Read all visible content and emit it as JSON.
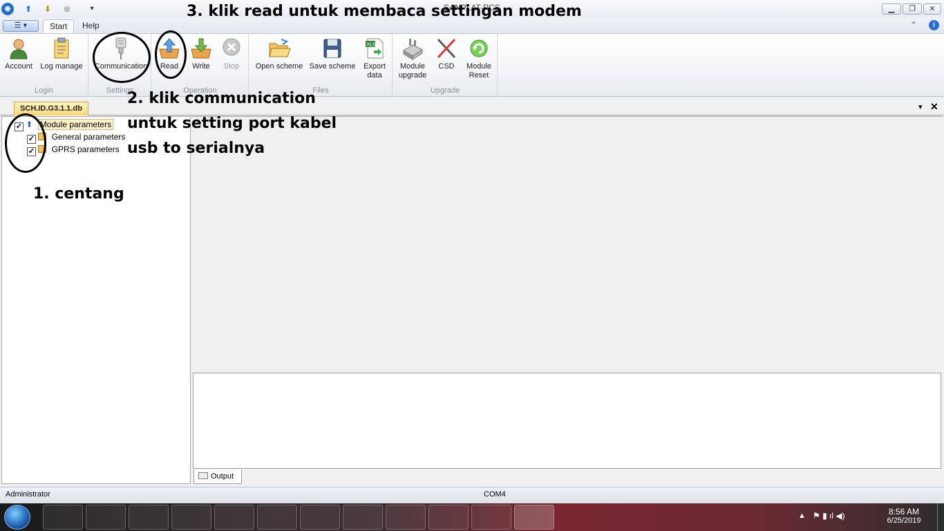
{
  "app": {
    "title": "SANPLAT-PCS",
    "menu_tab": "Start",
    "help_tab": "Help"
  },
  "ribbon": {
    "groups": [
      {
        "label": "Login",
        "buttons": [
          {
            "label": "Account"
          },
          {
            "label": "Log manage"
          }
        ]
      },
      {
        "label": "Settings",
        "buttons": [
          {
            "label": "Communication"
          }
        ]
      },
      {
        "label": "Operation",
        "buttons": [
          {
            "label": "Read"
          },
          {
            "label": "Write"
          },
          {
            "label": "Stop"
          }
        ]
      },
      {
        "label": "Files",
        "buttons": [
          {
            "label": "Open scheme"
          },
          {
            "label": "Save scheme"
          },
          {
            "label": "Export",
            "label2": "data"
          }
        ]
      },
      {
        "label": "Upgrade",
        "buttons": [
          {
            "label": "Module",
            "label2": "upgrade"
          },
          {
            "label": "CSD"
          },
          {
            "label": "Module",
            "label2": "Reset"
          }
        ]
      }
    ]
  },
  "document": {
    "tab_label": "SCH.ID.G3.1.1.db"
  },
  "tree": {
    "root": "Module parameters",
    "children": [
      "General parameters",
      "GPRS parameters"
    ]
  },
  "output": {
    "tab_label": "Output"
  },
  "status": {
    "user": "Administrator",
    "port": "COM4"
  },
  "tray": {
    "time": "8:56 AM",
    "date": "6/25/2019"
  },
  "annotations": {
    "step3": "3. klik read untuk membaca settingan modem",
    "step2_line1": "2. klik communication",
    "step2_line2": "untuk setting port kabel",
    "step2_line3": "usb to serialnya",
    "step1": "1. centang"
  }
}
